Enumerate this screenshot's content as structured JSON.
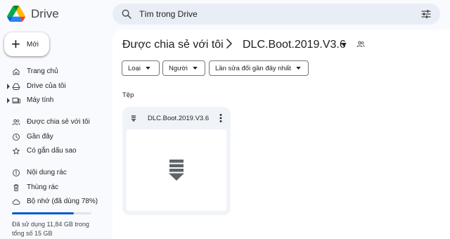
{
  "app": {
    "name": "Drive"
  },
  "search": {
    "placeholder": "Tìm trong Drive"
  },
  "new_button": {
    "label": "Mới"
  },
  "sidebar": {
    "items": [
      {
        "label": "Trang chủ",
        "icon": "home-icon"
      },
      {
        "label": "Drive của tôi",
        "icon": "drive-icon",
        "expandable": true
      },
      {
        "label": "Máy tính",
        "icon": "computer-icon",
        "expandable": true
      },
      {
        "label": "Được chia sẻ với tôi",
        "icon": "shared-icon"
      },
      {
        "label": "Gần đây",
        "icon": "clock-icon"
      },
      {
        "label": "Có gắn dấu sao",
        "icon": "star-icon"
      },
      {
        "label": "Nội dung rác",
        "icon": "spam-icon"
      },
      {
        "label": "Thùng rác",
        "icon": "trash-icon"
      },
      {
        "label": "Bộ nhớ (đã dùng 78%)",
        "icon": "cloud-icon"
      }
    ],
    "storage": {
      "used_fraction": 0.78,
      "text": "Đã sử dụng 11,84 GB trong tổng số 15 GB"
    }
  },
  "main": {
    "breadcrumb": {
      "parent": "Được chia sẻ với tôi",
      "current": "DLC.Boot.2019.V3.6"
    },
    "filters": [
      {
        "label": "Loại"
      },
      {
        "label": "Người"
      },
      {
        "label": "Lần sửa đổi gần đây nhất"
      }
    ],
    "section_label": "Tệp",
    "files": [
      {
        "name": "DLC.Boot.2019.V3.6",
        "icon": "archive-icon"
      }
    ]
  },
  "colors": {
    "page_bg": "#f8fafd",
    "search_bg": "#e9eef6",
    "card_bg": "#f0f4f9",
    "accent": "#0b57d0",
    "icon": "#444746"
  }
}
